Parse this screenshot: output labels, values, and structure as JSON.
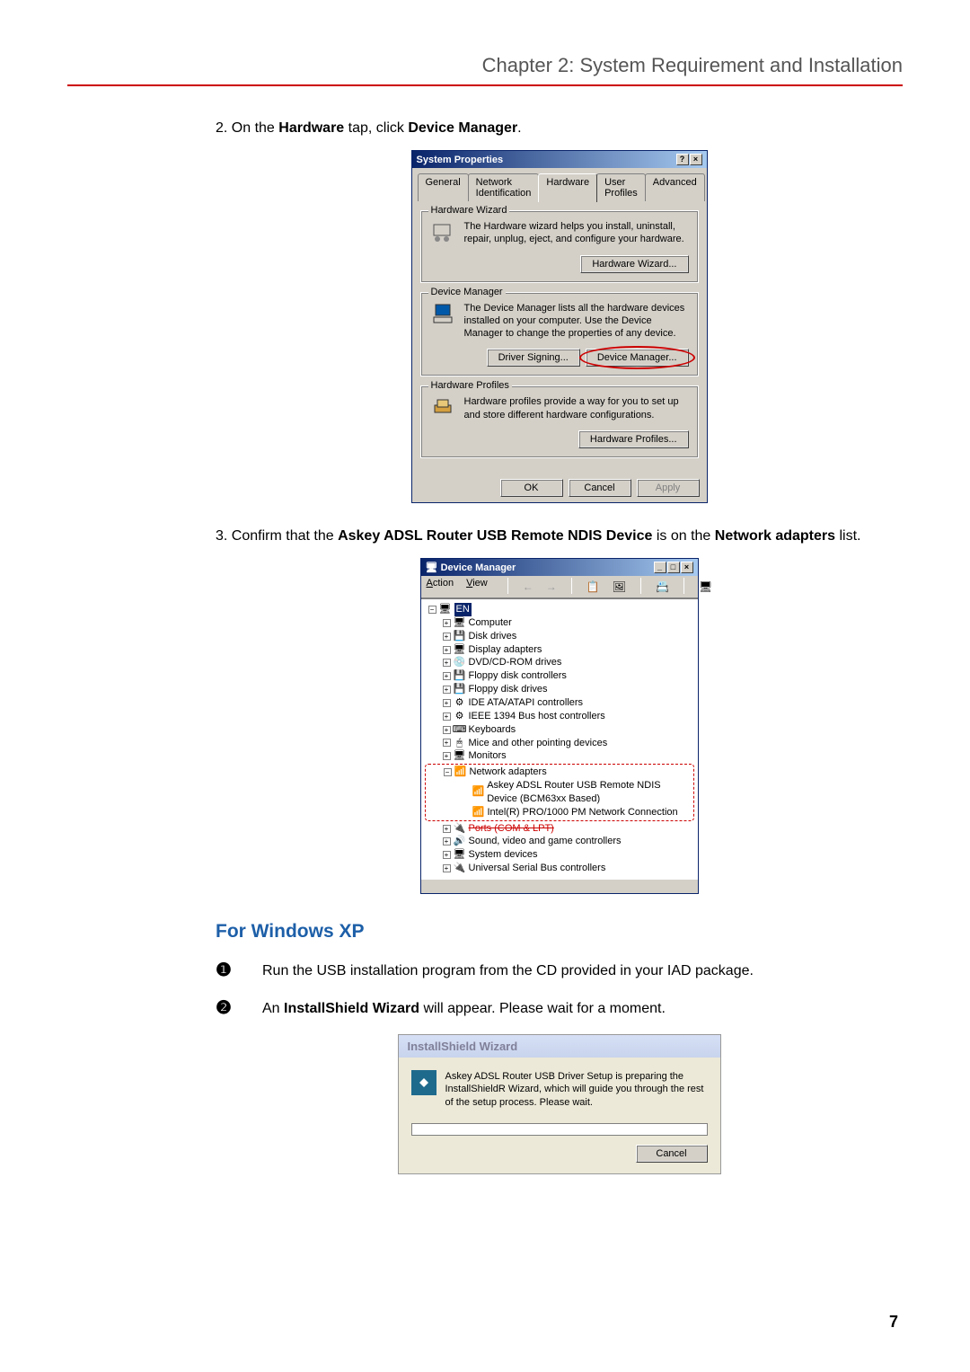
{
  "header": {
    "title": "Chapter 2: System Requirement and Installation"
  },
  "step2": {
    "prefix": "2.   On the ",
    "bold1": "Hardware",
    "mid": " tap, click ",
    "bold2": "Device Manager",
    "suffix": "."
  },
  "sysprops": {
    "title": "System Properties",
    "help_btn": "?",
    "close_btn": "×",
    "tabs": {
      "general": "General",
      "network_id": "Network Identification",
      "hardware": "Hardware",
      "user_profiles": "User Profiles",
      "advanced": "Advanced"
    },
    "hw_wizard_group": {
      "title": "Hardware Wizard",
      "text": "The Hardware wizard helps you install, uninstall, repair, unplug, eject, and configure your hardware.",
      "button": "Hardware Wizard..."
    },
    "device_mgr_group": {
      "title": "Device Manager",
      "text": "The Device Manager lists all the hardware devices installed on your computer. Use the Device Manager to change the properties of any device.",
      "driver_signing_btn": "Driver Signing...",
      "device_mgr_btn": "Device Manager..."
    },
    "hw_profiles_group": {
      "title": "Hardware Profiles",
      "text": "Hardware profiles provide a way for you to set up and store different hardware configurations.",
      "button": "Hardware Profiles..."
    },
    "buttons": {
      "ok": "OK",
      "cancel": "Cancel",
      "apply": "Apply"
    }
  },
  "step3": {
    "prefix": "3.   Confirm that the ",
    "bold1": "Askey ADSL Router USB Remote NDIS Device",
    "mid": " is on the ",
    "bold2": "Network adapters",
    "suffix": " list."
  },
  "devmgr": {
    "title": "Device Manager",
    "min_btn": "_",
    "max_btn": "□",
    "close_btn": "×",
    "menu": {
      "action": "Action",
      "view": "View"
    },
    "toolbar": {
      "back": "←",
      "fwd": "→",
      "prop": "⬚",
      "scan": "⚙",
      "remove": "✖",
      "refresh": "⟳"
    },
    "tree": {
      "root": "EN",
      "items": [
        "Computer",
        "Disk drives",
        "Display adapters",
        "DVD/CD-ROM drives",
        "Floppy disk controllers",
        "Floppy disk drives",
        "IDE ATA/ATAPI controllers",
        "IEEE 1394 Bus host controllers",
        "Keyboards",
        "Mice and other pointing devices",
        "Monitors"
      ],
      "network": {
        "label": "Network adapters",
        "child1": "Askey ADSL Router USB Remote NDIS Device (BCM63xx Based)",
        "child2": "Intel(R) PRO/1000 PM Network Connection"
      },
      "ports": "Ports (COM & LPT)",
      "rest": [
        "Sound, video and game controllers",
        "System devices",
        "Universal Serial Bus controllers"
      ]
    }
  },
  "xp_section": {
    "heading": "For Windows XP",
    "step1": {
      "num": "❶",
      "text": "Run the USB installation program from the CD provided in your IAD package."
    },
    "step2": {
      "num": "❷",
      "prefix": "An ",
      "bold": "InstallShield Wizard",
      "suffix": " will appear. Please wait for a moment."
    }
  },
  "ishield": {
    "title": "InstallShield Wizard",
    "body": "Askey ADSL Router USB Driver Setup is preparing the InstallShieldR Wizard, which will guide you through the rest of the setup process. Please wait.",
    "cancel": "Cancel"
  },
  "page_number": "7"
}
